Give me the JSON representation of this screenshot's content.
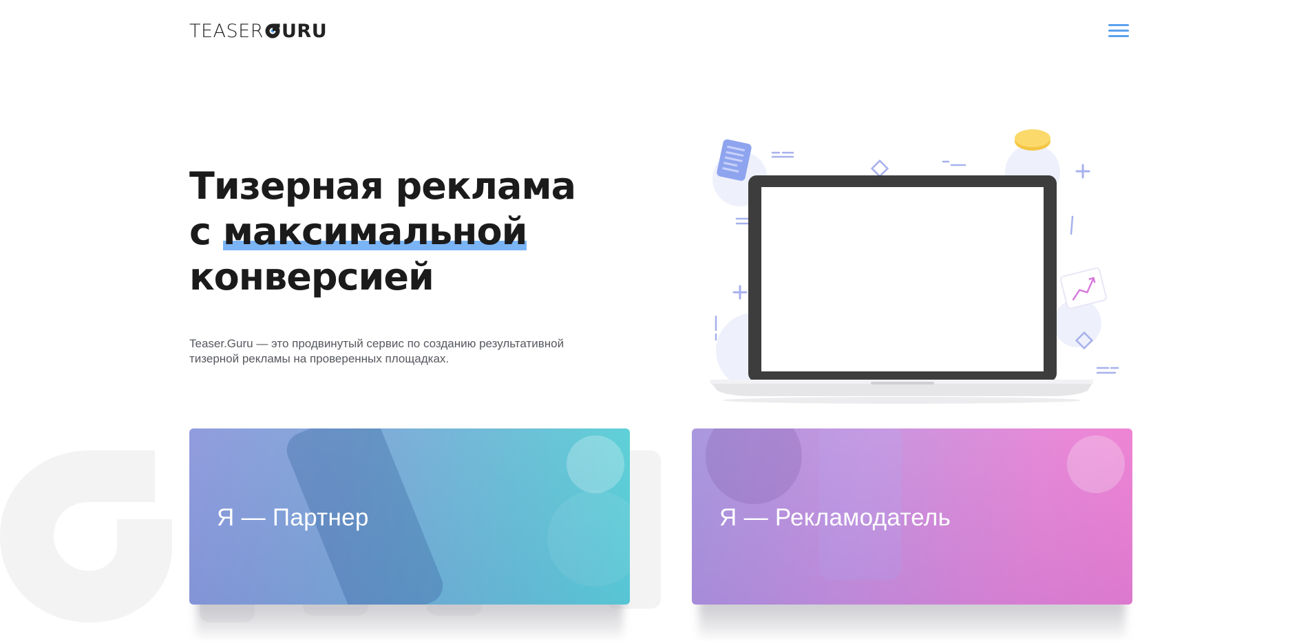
{
  "header": {
    "logo_teaser": "TEASER",
    "logo_guru": "URU",
    "menu_icon": "hamburger-menu-icon"
  },
  "hero": {
    "title_line1": "Тизерная реклама",
    "title_line2_prefix": "с ",
    "title_line2_highlight": "максимальной",
    "title_line3": "конверсией",
    "description_line1": "Teaser.Guru — это продвинутый сервис по созданию результативной",
    "description_line2": "тизерной рекламы на проверенных площадках."
  },
  "cards": {
    "partner_label": "Я — Партнер",
    "advertiser_label": "Я — Рекламодатель"
  },
  "colors": {
    "accent_blue": "#5aa0ee",
    "highlight": "#7ab4f5",
    "partner_gradient_start": "#8c97dc",
    "partner_gradient_end": "#4fd8d6",
    "advertiser_gradient_start": "#a493dd",
    "advertiser_gradient_end": "#f27bd0"
  }
}
